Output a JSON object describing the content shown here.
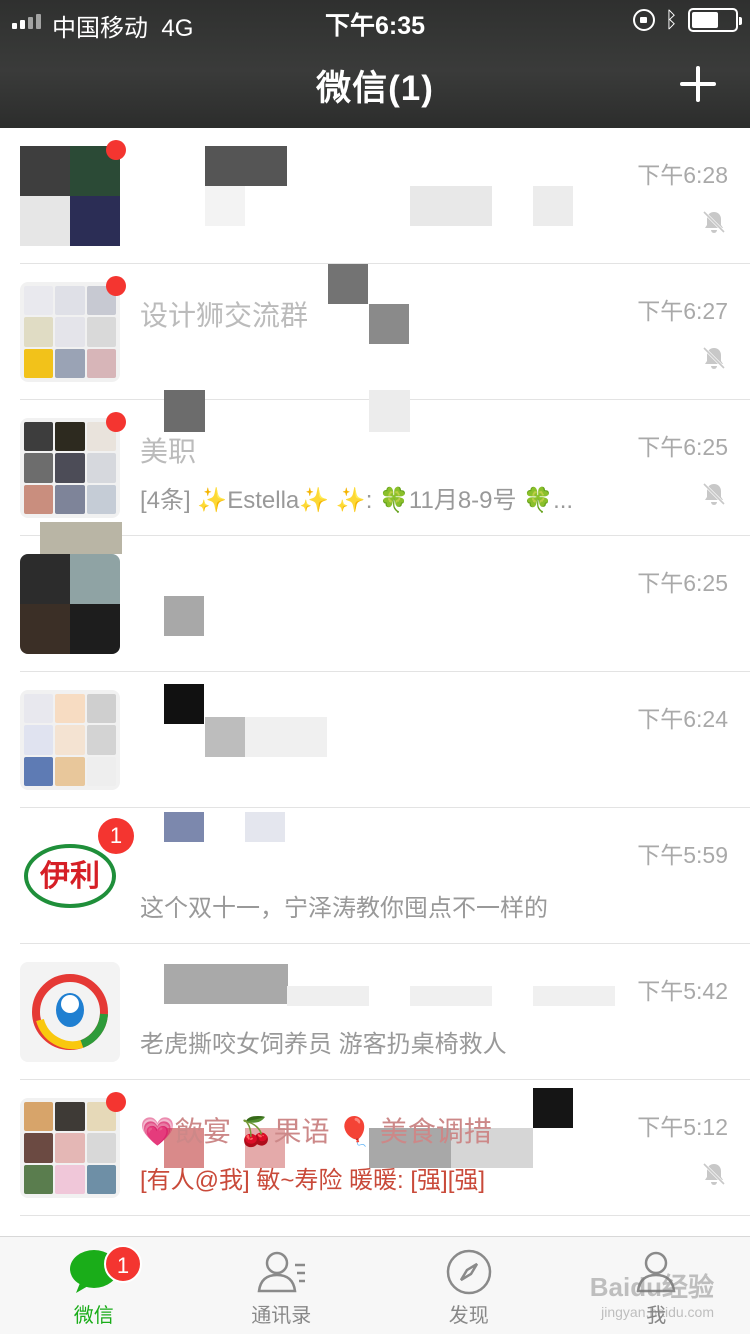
{
  "status_bar": {
    "carrier": "中国移动",
    "network": "4G",
    "time": "下午6:35",
    "battery_level": 0.62
  },
  "header": {
    "title": "微信(1)",
    "add_icon": "plus-icon"
  },
  "chats": [
    {
      "name": "",
      "preview": "",
      "time": "下午6:28",
      "muted": true,
      "unread_dot": true,
      "unread_count": ""
    },
    {
      "name": "设计狮交流群",
      "preview": "",
      "time": "下午6:27",
      "muted": true,
      "unread_dot": true,
      "unread_count": ""
    },
    {
      "name": "美职",
      "preview": "[4条] ✨Estella✨ ✨: 🍀11月8-9号 🍀...",
      "time": "下午6:25",
      "muted": true,
      "unread_dot": true,
      "unread_count": ""
    },
    {
      "name": "",
      "preview": "",
      "time": "下午6:25",
      "muted": false,
      "unread_dot": false,
      "unread_count": ""
    },
    {
      "name": "",
      "preview": "",
      "time": "下午6:24",
      "muted": false,
      "unread_dot": false,
      "unread_count": ""
    },
    {
      "name": "",
      "preview": "这个双十一，宁泽涛教你囤点不一样的",
      "time": "下午5:59",
      "muted": false,
      "unread_dot": false,
      "unread_count": "1",
      "avatar_text": "伊利"
    },
    {
      "name": "",
      "preview": "老虎撕咬女饲养员 游客扔桌椅救人",
      "time": "下午5:42",
      "muted": false,
      "unread_dot": false,
      "unread_count": ""
    },
    {
      "name": "💗飲宴 🍒果语 🎈 美食调措",
      "preview": "[有人@我] 敏~寿险 暖暖: [强][强]",
      "time": "下午5:12",
      "muted": true,
      "unread_dot": true,
      "unread_count": ""
    }
  ],
  "tabbar": {
    "tabs": [
      {
        "label": "微信",
        "icon": "chat-bubble-icon",
        "active": true,
        "badge": "1"
      },
      {
        "label": "通讯录",
        "icon": "contacts-icon",
        "active": false,
        "badge": ""
      },
      {
        "label": "发现",
        "icon": "compass-icon",
        "active": false,
        "badge": ""
      },
      {
        "label": "我",
        "icon": "person-icon",
        "active": false,
        "badge": ""
      }
    ]
  },
  "watermark": {
    "brand": "Baidu经验",
    "url": "jingyan.baidu.com"
  },
  "colors": {
    "accent": "#1aad19",
    "badge": "#f43530",
    "header": "#333333"
  }
}
